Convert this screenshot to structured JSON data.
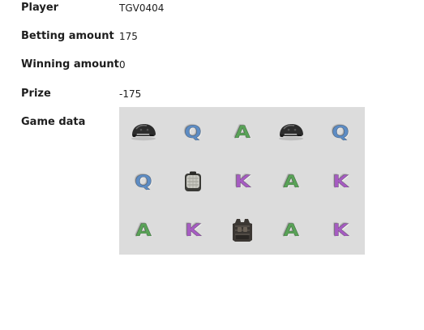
{
  "fields": {
    "player": {
      "label": "Player",
      "value": "TGV0404"
    },
    "betting": {
      "label": "Betting amount",
      "value": "175"
    },
    "winning": {
      "label": "Winning amount",
      "value": "0"
    },
    "prize": {
      "label": "Prize",
      "value": "-175"
    },
    "game_data": {
      "label": "Game data"
    }
  },
  "reels": {
    "background": "#dcdcdc",
    "rows": [
      [
        "helmet",
        "Q",
        "A",
        "helmet",
        "Q"
      ],
      [
        "Q",
        "backpack",
        "K",
        "A",
        "K"
      ],
      [
        "A",
        "K",
        "vest",
        "A",
        "K"
      ]
    ],
    "symbol_colors": {
      "Q": "#5d8cc4",
      "A": "#59a257",
      "K": "#a65cc2"
    },
    "icons": {
      "helmet": "helmet-icon",
      "backpack": "backpack-icon",
      "vest": "armor-vest-icon"
    }
  }
}
